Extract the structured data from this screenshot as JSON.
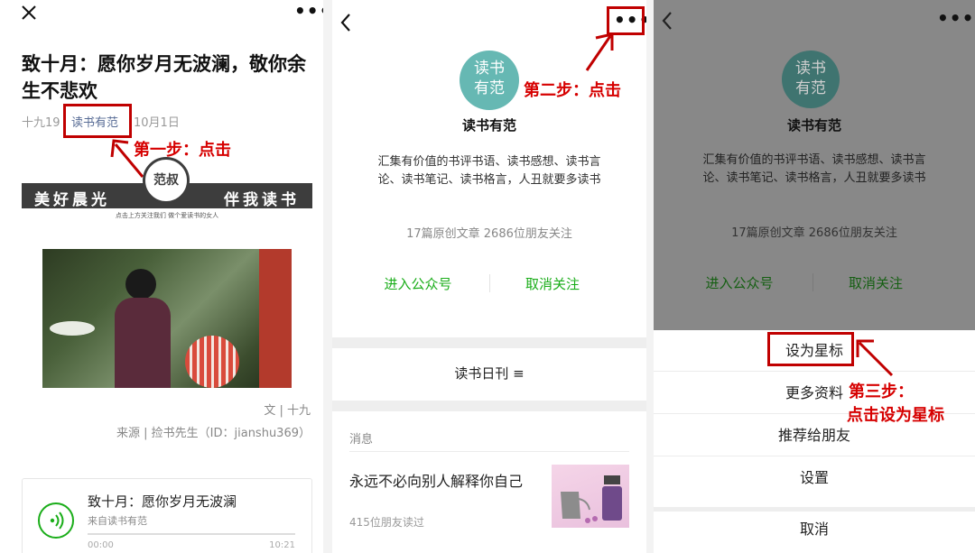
{
  "panel1": {
    "article_title": "致十月：愿你岁月无波澜，敬你余生不悲欢",
    "meta_prefix": "十九19",
    "author": "读书有范",
    "date": "10月1日",
    "step_label": "第一步：点击",
    "banner_left": "美好晨光",
    "banner_right": "伴我读书",
    "banner_logo": "范叔",
    "banner_sub": "点击上方关注我们    做个爱读书的女人",
    "credit_text": "文 | 十九",
    "credit_source": "来源 | 捡书先生（ID：jianshu369）",
    "audio_title": "致十月：愿你岁月无波澜",
    "audio_from": "来自读书有范",
    "audio_start": "00:00",
    "audio_end": "10:21"
  },
  "panel2": {
    "logo_line1": "读书",
    "logo_line2": "有范",
    "step_label": "第二步：点击",
    "account_name": "读书有范",
    "description": "汇集有价值的书评书语、读书感想、读书言论、读书笔记、读书格言，人丑就要多读书",
    "stats": "17篇原创文章  2686位朋友关注",
    "enter_label": "进入公众号",
    "unfollow_label": "取消关注",
    "daily_label": "读书日刊 ≡",
    "section_label": "消息",
    "message_title": "永远不必向别人解释你自己",
    "message_reads": "415位朋友读过"
  },
  "panel3": {
    "logo_line1": "读书",
    "logo_line2": "有范",
    "account_name": "读书有范",
    "description": "汇集有价值的书评书语、读书感想、读书言论、读书笔记、读书格言，人丑就要多读书",
    "stats": "17篇原创文章  2686位朋友关注",
    "enter_label": "进入公众号",
    "unfollow_label": "取消关注",
    "menu_star": "设为星标",
    "menu_more": "更多资料",
    "menu_recommend": "推荐给朋友",
    "menu_settings": "设置",
    "menu_cancel": "取消",
    "step_label_1": "第三步：",
    "step_label_2": "点击设为星标"
  },
  "colors": {
    "accent_red": "#d60000",
    "wechat_green": "#1aad19",
    "link_blue": "#576b95",
    "logo_teal": "#66b8b3"
  }
}
